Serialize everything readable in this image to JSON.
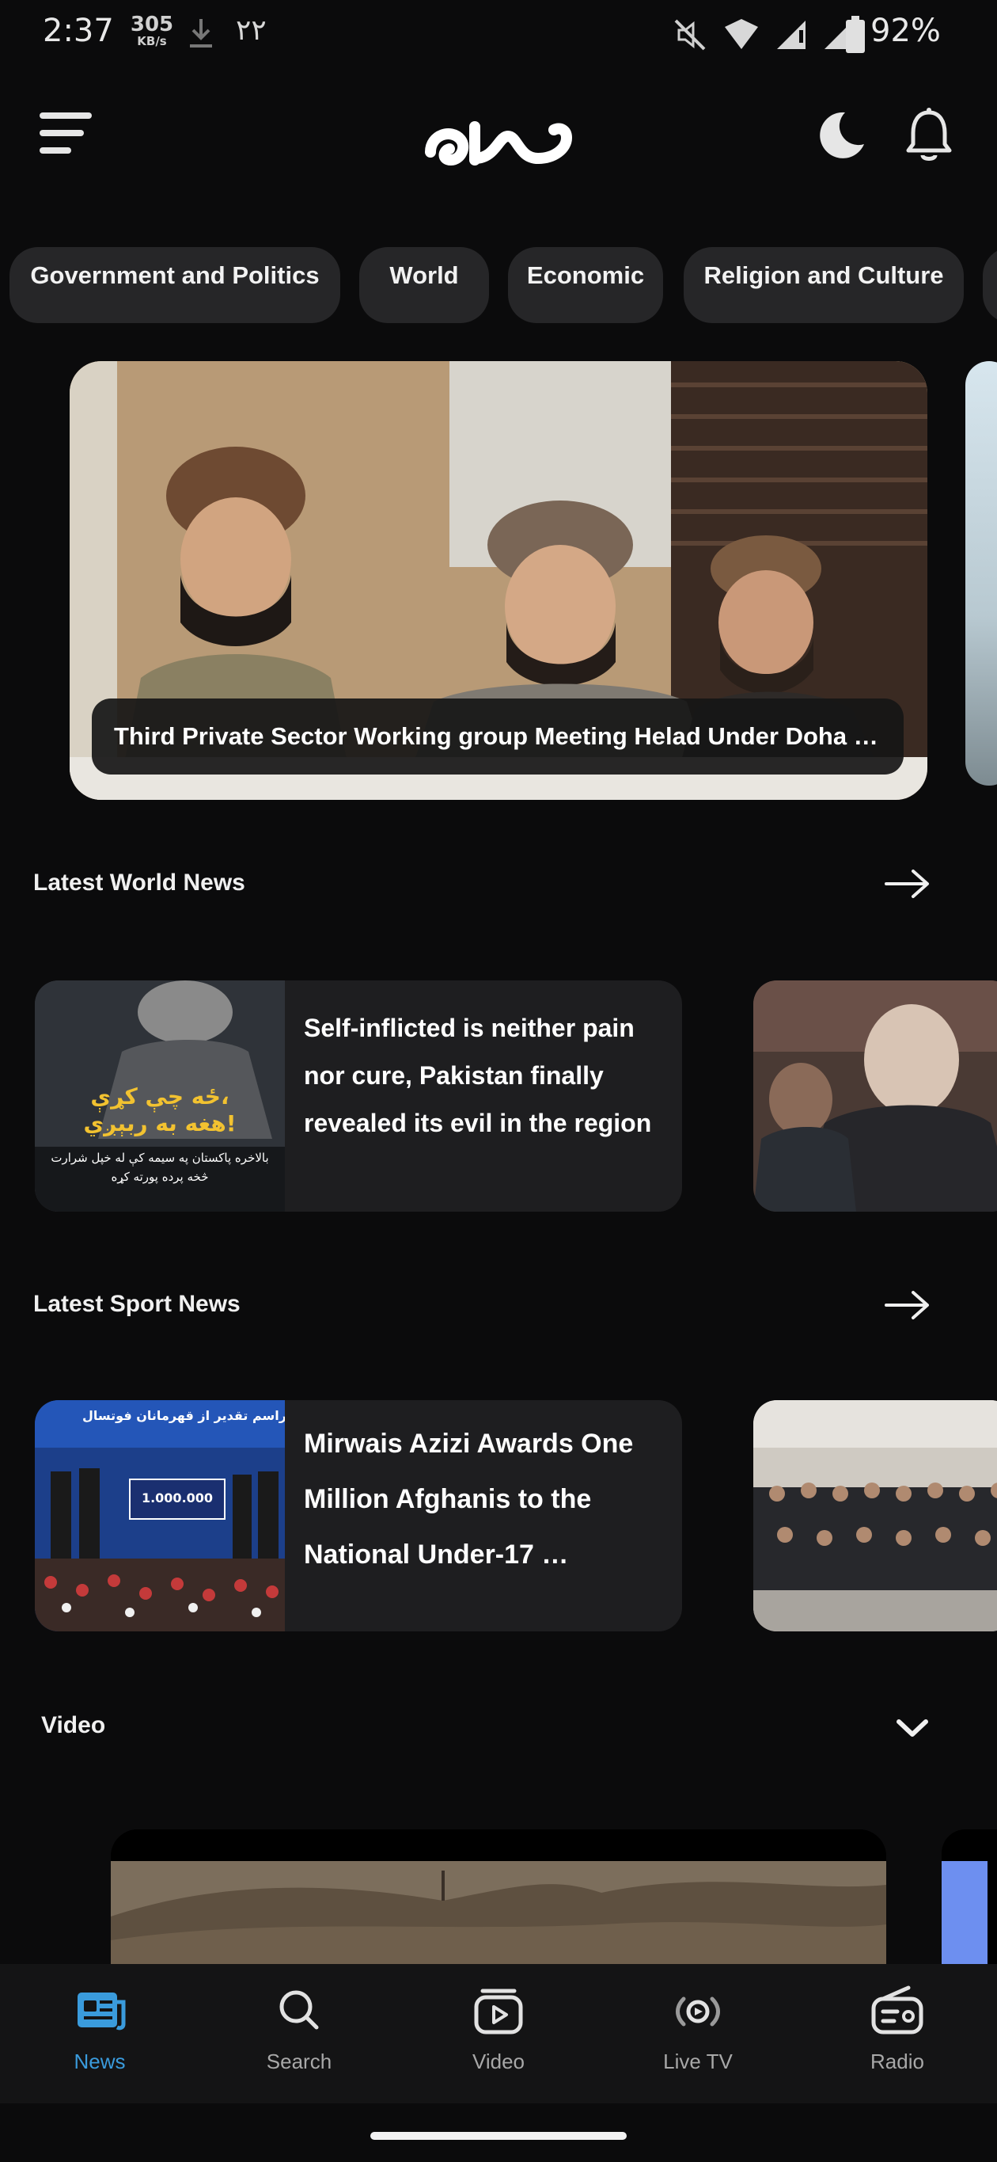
{
  "status_bar": {
    "time": "2:37",
    "speed_value": "305",
    "speed_unit": "KB/s",
    "notification_count": "٢٢",
    "battery": "92%"
  },
  "header": {
    "logo_icon": "mili-logo",
    "menu_icon": "hamburger-icon",
    "theme_icon": "moon-icon",
    "notification_icon": "bell-icon"
  },
  "categories": [
    {
      "label": "Government and Politics"
    },
    {
      "label": "World"
    },
    {
      "label": "Economic"
    },
    {
      "label": "Religion and Culture"
    }
  ],
  "hero": {
    "caption": "Third Private Sector Working group Meeting Helad Under Doha Pr…"
  },
  "sections": {
    "world": {
      "title": "Latest World News",
      "card_title": "Self-inflicted is neither pain nor cure, Pakistan finally revealed its evil in the region",
      "thumb_text_1": "ځه چې کړې،",
      "thumb_text_2": "هغه به ربېږي!",
      "thumb_text_3": "بالاخره پاکستان په سیمه کې له خپل شرارت",
      "thumb_text_4": "څخه پرده پورته کړه"
    },
    "sport": {
      "title": "Latest Sport News",
      "card_title": "Mirwais Azizi Awards One Million Afghanis to the National Under-17 …",
      "thumb_text_1": "مراسم تقدیر از قهرمانان فوتسال",
      "thumb_text_2": "1.000.000"
    },
    "video": {
      "title": "Video"
    }
  },
  "bottom_nav": [
    {
      "label": "News",
      "icon": "newspaper-icon",
      "active": true
    },
    {
      "label": "Search",
      "icon": "search-icon",
      "active": false
    },
    {
      "label": "Video",
      "icon": "video-play-icon",
      "active": false
    },
    {
      "label": "Live TV",
      "icon": "live-broadcast-icon",
      "active": false
    },
    {
      "label": "Radio",
      "icon": "radio-icon",
      "active": false
    }
  ],
  "colors": {
    "background": "#0b0b0c",
    "chip": "#262628",
    "card": "#1e1e20",
    "accent": "#3a9bdc"
  }
}
